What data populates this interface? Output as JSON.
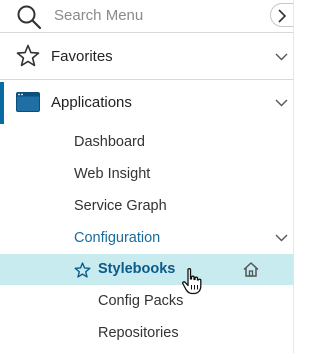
{
  "search": {
    "placeholder": "Search Menu",
    "icon": "search-icon"
  },
  "collapse": {
    "icon": "chevron-right-icon"
  },
  "favorites": {
    "label": "Favorites",
    "icon": "star-icon",
    "chevron": "chevron-down-icon"
  },
  "applications": {
    "label": "Applications",
    "icon": "applications-window-icon",
    "chevron": "chevron-down-icon",
    "accent_color": "#0b6aa2",
    "items": [
      {
        "label": "Dashboard"
      },
      {
        "label": "Web Insight"
      },
      {
        "label": "Service Graph"
      }
    ],
    "configuration": {
      "label": "Configuration",
      "chevron": "chevron-down-icon",
      "selected": {
        "label": "Stylebooks",
        "icon": "star-icon",
        "action_icon": "home-icon",
        "highlight_color": "#c7ebee"
      },
      "items": [
        {
          "label": "Config Packs"
        },
        {
          "label": "Repositories"
        }
      ]
    }
  }
}
